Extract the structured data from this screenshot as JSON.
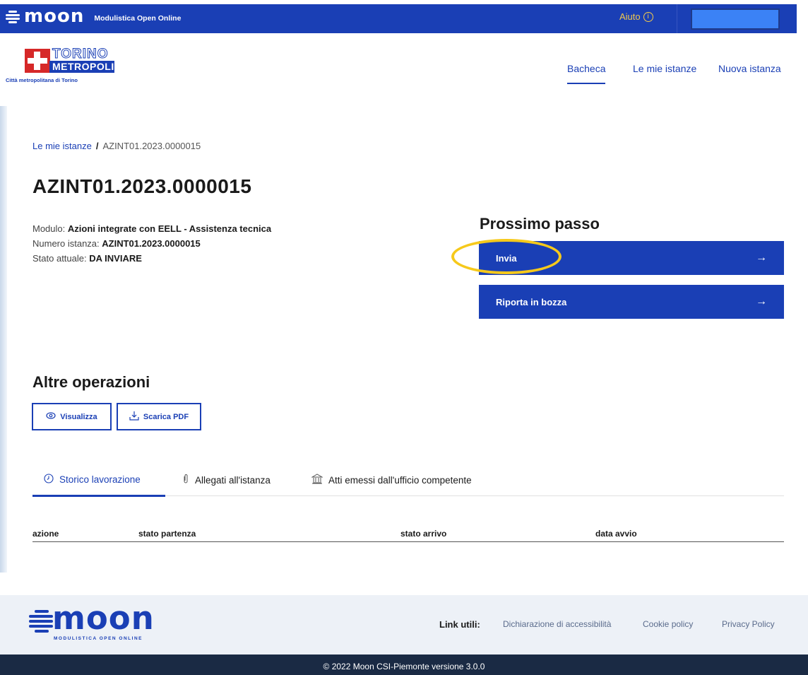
{
  "topbar": {
    "brand": "moon",
    "brand_subtitle": "Modulistica Open Online",
    "help_label": "Aiuto",
    "help_icon": "info-circle-icon",
    "user_icon": "user-icon"
  },
  "logo": {
    "line1": "TORINO",
    "line2": "METROPOLI",
    "line3": "Città metropolitana di Torino"
  },
  "nav": {
    "items": [
      {
        "label": "Bacheca",
        "active": true
      },
      {
        "label": "Le mie istanze",
        "active": false
      },
      {
        "label": "Nuova istanza",
        "active": false
      }
    ]
  },
  "breadcrumb": {
    "parent": "Le mie istanze",
    "separator": "/",
    "current": "AZINT01.2023.0000015"
  },
  "page": {
    "title": "AZINT01.2023.0000015"
  },
  "info": {
    "modulo_label": "Modulo:",
    "modulo_value": "Azioni integrate con EELL - Assistenza tecnica",
    "numero_label": "Numero istanza:",
    "numero_value": "AZINT01.2023.0000015",
    "stato_label": "Stato attuale:",
    "stato_value": "DA INVIARE"
  },
  "next_step": {
    "title": "Prossimo passo",
    "actions": [
      {
        "label": "Invia",
        "arrow": "→"
      },
      {
        "label": "Riporta in bozza",
        "arrow": "→"
      }
    ],
    "highlight_color": "#f6c91b"
  },
  "other_ops": {
    "title": "Altre operazioni",
    "view_label": "Visualizza",
    "pdf_label": "Scarica PDF"
  },
  "tabs": [
    {
      "label": "Storico lavorazione",
      "icon": "clock-icon",
      "active": true
    },
    {
      "label": "Allegati all'istanza",
      "icon": "paperclip-icon",
      "active": false
    },
    {
      "label": "Atti emessi dall'ufficio competente",
      "icon": "bank-icon",
      "active": false
    }
  ],
  "table": {
    "headers": [
      "azione",
      "stato partenza",
      "stato arrivo",
      "data avvio"
    ]
  },
  "footer": {
    "brand": "moon",
    "brand_subtitle": "MODULISTICA OPEN ONLINE",
    "links_label": "Link utili:",
    "links": [
      "Dichiarazione di accessibilità",
      "Cookie policy",
      "Privacy Policy"
    ],
    "copyright": "© 2022 Moon CSI-Piemonte versione 3.0.0"
  },
  "colors": {
    "primary": "#1a3fb5",
    "accent": "#f2c94c",
    "footer_bg": "#edf1f7",
    "copyright_bg": "#1a2a44"
  }
}
